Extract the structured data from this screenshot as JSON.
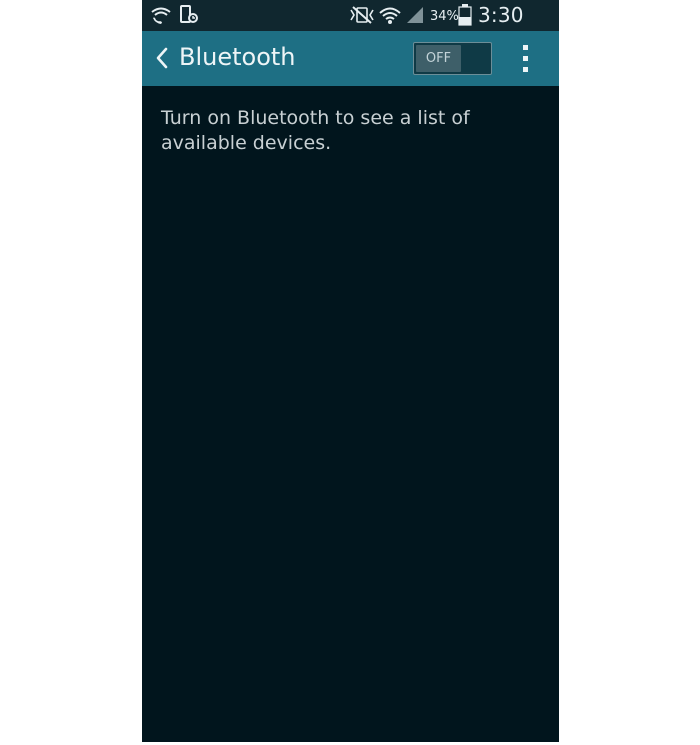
{
  "status_bar": {
    "battery_percent": "34%",
    "time": "3:30 PM",
    "icons": [
      "wifi-calling-icon",
      "screen-mirroring-icon",
      "vibrate-mute-icon",
      "wifi-icon",
      "signal-icon",
      "battery-icon"
    ]
  },
  "action_bar": {
    "title": "Bluetooth",
    "toggle_label": "OFF",
    "toggle_state": "off"
  },
  "content": {
    "message": "Turn on Bluetooth to see a list of available devices."
  },
  "colors": {
    "action_bar_bg": "#1e6f84",
    "screen_bg": "#01151d",
    "status_bar_bg": "#10272f"
  }
}
